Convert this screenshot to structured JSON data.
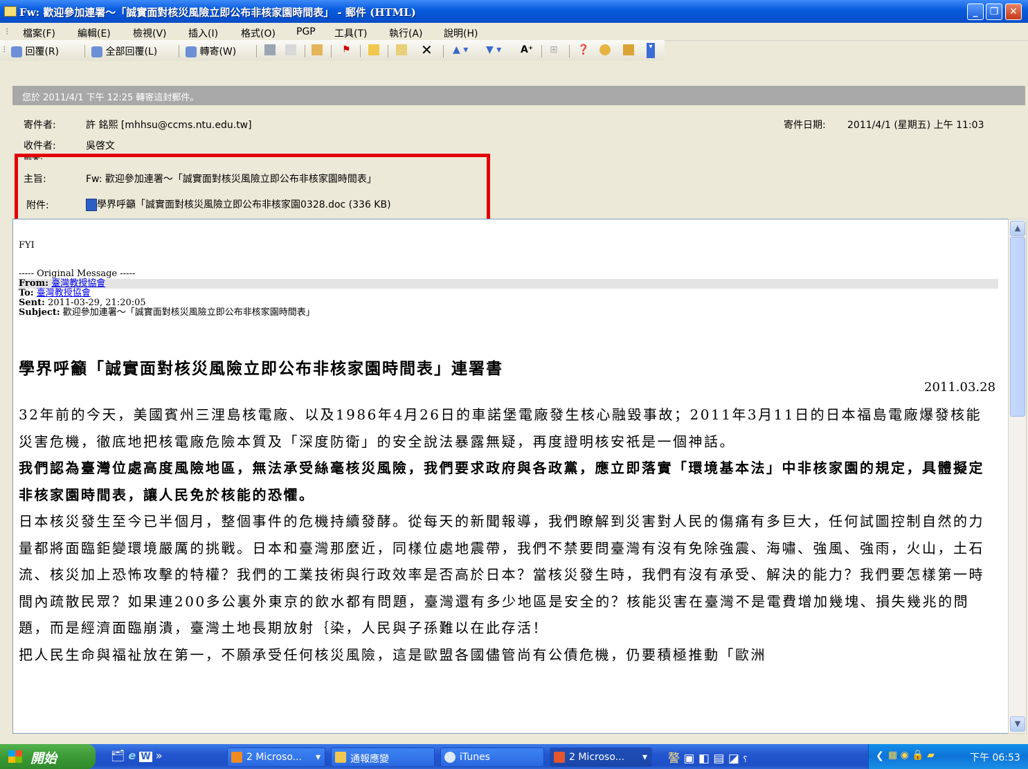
{
  "window": {
    "title": "Fw: 歡迎參加連署～「誠實面對核災風險立即公布非核家園時間表」 - 郵件 (HTML)",
    "buttons": [
      "_",
      "▫",
      "✕"
    ]
  },
  "menu": [
    "檔案(F)",
    "編輯(E)",
    "檢視(V)",
    "插入(I)",
    "格式(O)",
    "PGP",
    "工具(T)",
    "執行(A)",
    "說明(H)"
  ],
  "toolbar": {
    "reply": "回覆(R)",
    "reply_all": "全部回覆(L)",
    "forward": "轉寄(W)"
  },
  "info_bar": "您於 2011/4/1 下午 12:25 轉寄這封郵件。",
  "header": {
    "from_label": "寄件者:",
    "from_value": "許 銘熙 [mhhsu@ccms.ntu.edu.tw]",
    "sent_label": "寄件日期:",
    "sent_value": "2011/4/1 (星期五) 上午 11:03",
    "to_label": "收件者:",
    "to_value": "吳啓文",
    "cc_label": "副本:",
    "subject_label": "主旨:",
    "subject_value": "Fw: 歡迎參加連署～「誠實面對核災風險立即公布非核家園時間表」",
    "attach_label": "附件:",
    "attach_value": "學界呼籲「誠實面對核災風險立即公布非核家園0328.doc (336 KB)"
  },
  "body": {
    "fyi": "FYI",
    "orig_marker": "----- Original Message -----",
    "from_label": "From:",
    "from_value": "臺灣教授協會",
    "to_label": "To:",
    "to_value": "臺灣教授協會",
    "sent_label": "Sent:",
    "sent_value": "2011-03-29, 21:20:05",
    "subject_label": "Subject:",
    "subject_value": "歡迎參加連署～「誠實面對核災風險立即公布非核家園時間表」",
    "title": "學界呼籲「誠實面對核災風險立即公布非核家園時間表」連署書",
    "date": "2011.03.28",
    "p1": "32年前的今天，美國賓州三浬島核電廠、以及1986年4月26日的車諾堡電廠發生核心融毀事故；2011年3月11日的日本福島電廠爆發核能災害危機，徹底地把核電廠危險本質及「深度防衛」的安全說法暴露無疑，再度證明核安祇是一個神話。",
    "p2": "我們認為臺灣位處高度風險地區，無法承受絲毫核災風險，我們要求政府與各政黨，應立即落實「環境基本法」中非核家園的規定，具體擬定非核家園時間表，讓人民免於核能的恐懼。",
    "p3": "日本核災發生至今已半個月，整個事件的危機持續發酵。從每天的新聞報導，我們瞭解到災害對人民的傷痛有多巨大，任何試圖控制自然的力量都將面臨鉅變環境嚴厲的挑戰。日本和臺灣那麼近，同樣位處地震帶，我們不禁要問臺灣有沒有免除強震、海嘯、強風、強雨，火山，土石流、核災加上恐怖攻擊的特權？我們的工業技術與行政效率是否高於日本？當核災發生時，我們有沒有承受、解決的能力？我們要怎樣第一時間內疏散民眾？如果連200多公裏外東京的飲水都有問題，臺灣還有多少地區是安全的？核能災害在臺灣不是電費增加幾塊、損失幾兆的問題，而是經濟面臨崩潰，臺灣土地長期放射｛染，人民與子孫難以在此存活！",
    "p4": "把人民生命與福祉放在第一，不願承受任何核災風險，這是歐盟各國儘管尚有公債危機，仍要積極推動「歐洲"
  },
  "taskbar": {
    "start": "開始",
    "tasks": [
      "2 Microso...",
      "通報應變",
      "iTunes",
      "2 Microso..."
    ],
    "clock": "下午 06:53"
  },
  "colors": {
    "highlight_box": "#e30000",
    "title_bar": "#0a5ddf",
    "info_bar": "#a8a8a8"
  }
}
